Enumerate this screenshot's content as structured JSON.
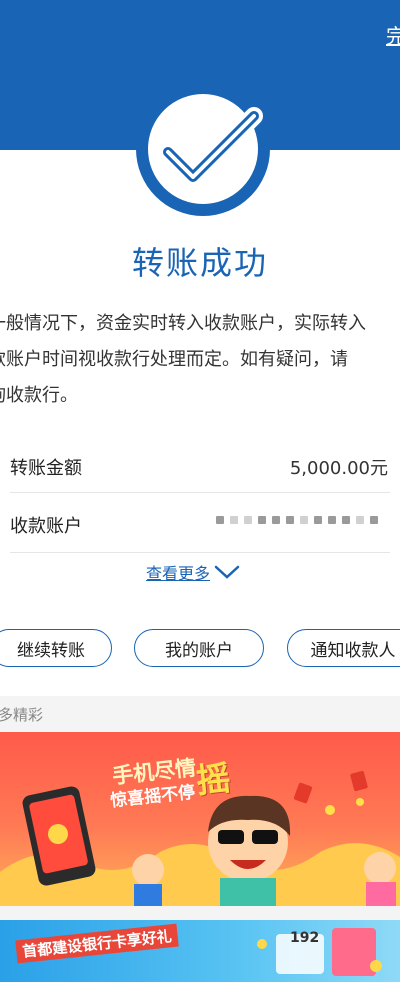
{
  "header": {
    "done_label": "完"
  },
  "result": {
    "title": "转账成功",
    "notice_lines": [
      "一般情况下，资金实时转入收款账户，实际转入",
      "款账户时间视收款行处理而定。如有疑问，请",
      "询收款行。"
    ]
  },
  "details": {
    "amount_label": "转账金额",
    "amount_value": "5,000.00元",
    "account_label": "收款账户"
  },
  "more": {
    "label": "查看更多"
  },
  "actions": {
    "continue_label": "继续转账",
    "my_account_label": "我的账户",
    "notify_label": "通知收款人"
  },
  "section": {
    "title": "多精彩"
  },
  "banner1": {
    "line1": "手机尽情",
    "line2": "惊喜摇不停",
    "big": "摇"
  },
  "banner2": {
    "text": "首都建设银行卡享好礼",
    "number": "192"
  },
  "colors": {
    "primary": "#1a64b5",
    "banner_red": "#ff5a4a",
    "banner_blue": "#2aa0e8"
  }
}
